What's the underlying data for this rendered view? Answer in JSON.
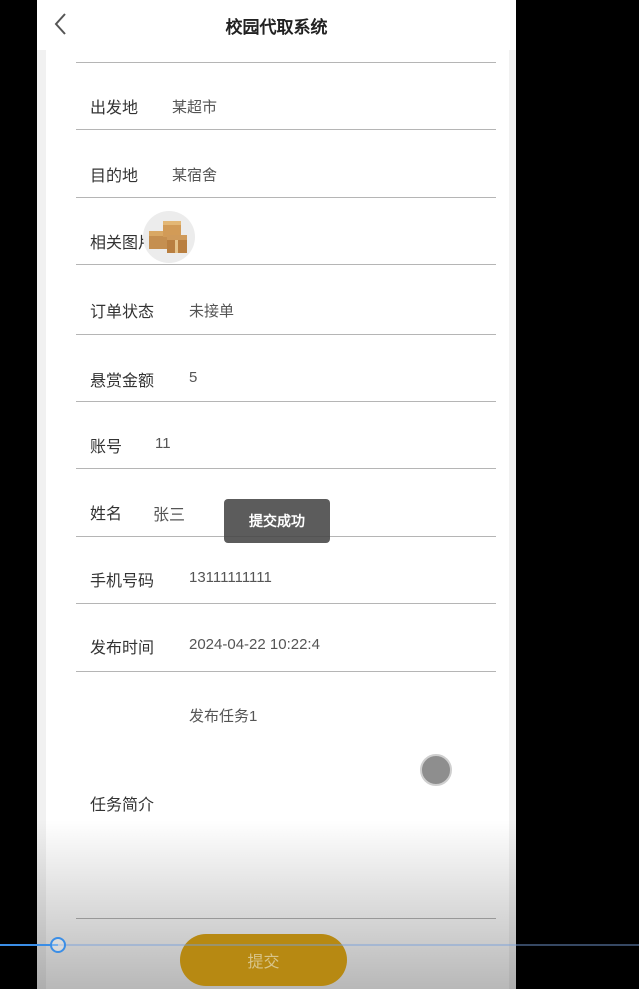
{
  "header": {
    "title": "校园代取系统",
    "back_icon": "chevron-left-icon"
  },
  "fields": {
    "origin": {
      "label": "出发地",
      "value": "某超市"
    },
    "destination": {
      "label": "目的地",
      "value": "某宿舍"
    },
    "image": {
      "label": "相关图片",
      "icon": "package-image"
    },
    "status": {
      "label": "订单状态",
      "value": "未接单"
    },
    "reward": {
      "label": "悬赏金额",
      "value": "5"
    },
    "account": {
      "label": "账号",
      "value": "11"
    },
    "name": {
      "label": "姓名",
      "value": "张三"
    },
    "phone": {
      "label": "手机号码",
      "value": "13111111111"
    },
    "publish_time": {
      "label": "发布时间",
      "value": "2024-04-22 10:22:4"
    },
    "intro": {
      "label": "任务简介",
      "value": "发布任务1"
    }
  },
  "toast": {
    "text": "提交成功"
  },
  "submit": {
    "label": "提交"
  },
  "video_progress": {
    "fraction": 0.09
  },
  "colors": {
    "accent": "#b78912",
    "progress": "#3b8ee6"
  }
}
